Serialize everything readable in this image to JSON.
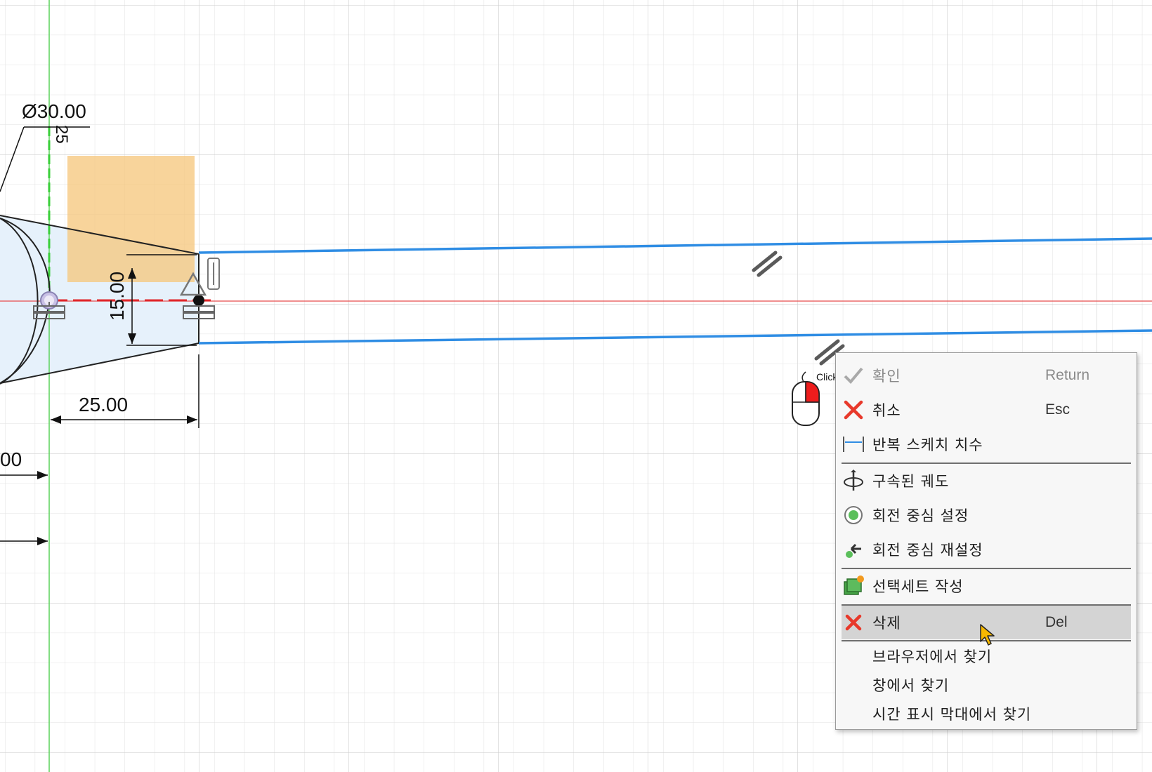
{
  "dimensions": {
    "diameter": "Ø30.00",
    "vertical_small": "25",
    "height": "15.00",
    "width": "25.00",
    "partial_left": "00"
  },
  "cursor_hint": {
    "click_label": "Click!"
  },
  "context_menu": {
    "items": [
      {
        "label": "확인",
        "shortcut": "Return",
        "icon": "checkmark-icon",
        "disabled": true
      },
      {
        "label": "취소",
        "shortcut": "Esc",
        "icon": "cancel-x-icon"
      },
      {
        "label": "반복 스케치 치수",
        "shortcut": "",
        "icon": "sketch-dimension-icon"
      },
      {
        "label": "구속된 궤도",
        "shortcut": "",
        "icon": "constrained-orbit-icon"
      },
      {
        "label": "회전 중심 설정",
        "shortcut": "",
        "icon": "orbit-center-icon"
      },
      {
        "label": "회전 중심 재설정",
        "shortcut": "",
        "icon": "reset-orbit-center-icon"
      },
      {
        "label": "선택세트 작성",
        "shortcut": "",
        "icon": "selection-set-icon"
      },
      {
        "label": "삭제",
        "shortcut": "Del",
        "icon": "delete-x-icon",
        "hover": true
      },
      {
        "label": "브라우저에서 찾기",
        "shortcut": ""
      },
      {
        "label": "창에서 찾기",
        "shortcut": ""
      },
      {
        "label": "시간 표시 막대에서 찾기",
        "shortcut": ""
      }
    ]
  },
  "colors": {
    "selected_line": "#2f8de4",
    "axis_red": "#e84c4c",
    "axis_green": "#3ccc3c",
    "highlight_fill": "#f5c67a",
    "profile_fill": "#e6f1fb",
    "grid": "#dcdcdc"
  }
}
